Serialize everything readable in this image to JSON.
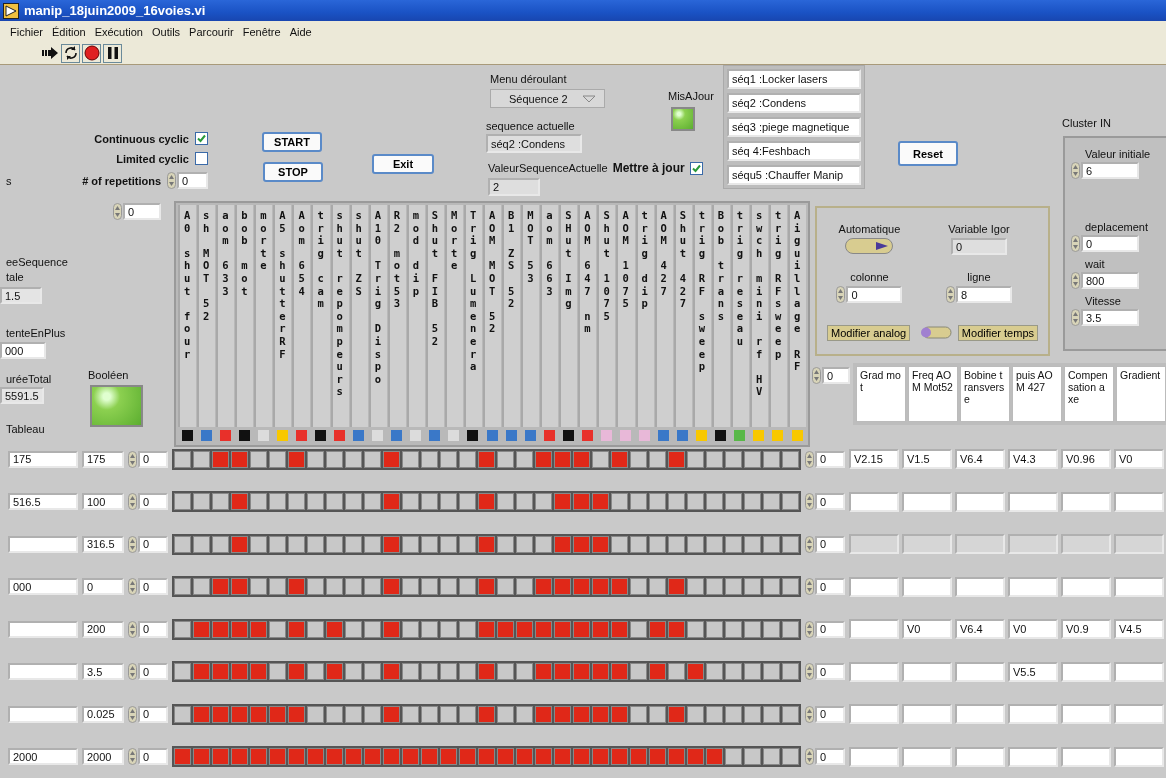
{
  "window": {
    "title": "manip_18juin2009_16voies.vi"
  },
  "menu": [
    "Fichier",
    "Édition",
    "Exécution",
    "Outils",
    "Parcourir",
    "Fenêtre",
    "Aide"
  ],
  "left_cut": {
    "top_label": "s",
    "duration_label": "eeSequence tale",
    "duration_value": "1.5",
    "wait_label": "tenteEnPlus",
    "wait_value": "000",
    "total_label": "uréeTotal",
    "total_value": "5591.5",
    "table_label": "Tableau"
  },
  "continuous_cyclic": {
    "label": "Continuous cyclic",
    "checked": true
  },
  "limited_cyclic": {
    "label": "Limited cyclic",
    "checked": false
  },
  "repetitions": {
    "label": "# of repetitions",
    "value": "0"
  },
  "buttons": {
    "start": "START",
    "stop": "STOP",
    "exit": "Exit",
    "reset": "Reset"
  },
  "dropdown": {
    "label": "Menu déroulant",
    "value": "Séquence 2"
  },
  "misajour": {
    "label": "MisAJour",
    "on": true
  },
  "sequence_actuelle": {
    "label": "sequence actuelle",
    "value": "séq2 :Condens"
  },
  "valeur_sequence": {
    "label": "ValeurSequenceActuelle",
    "value": "2"
  },
  "mettre_a_jour": {
    "label": "Mettre à jour",
    "checked": true
  },
  "sequences": [
    "séq1 :Locker lasers",
    "séq2 :Condens",
    "séq3 :piege magnetique",
    "séq 4:Feshbach",
    "séqu5 :Chauffer Manip"
  ],
  "booleen": {
    "label": "Booléen",
    "on": true
  },
  "cluster": {
    "label": "Cluster IN",
    "fields": [
      {
        "label": "Valeur initiale",
        "value": "6"
      },
      {
        "label": "deplacement",
        "value": "0"
      },
      {
        "label": "wait",
        "value": "800"
      },
      {
        "label": "Vitesse",
        "value": "3.5"
      }
    ]
  },
  "igor": {
    "automatique": {
      "label": "Automatique",
      "on": true
    },
    "variable": {
      "label": "Variable Igor",
      "value": "0"
    },
    "colonne": {
      "label": "colonne",
      "value": "0"
    },
    "ligne": {
      "label": "ligne",
      "value": "8"
    },
    "modifier_analog": "Modifier analog",
    "modifier_temps": "Modifier temps"
  },
  "channel_index": "0",
  "channels": [
    {
      "name": "A0 shut four",
      "color": "#111111"
    },
    {
      "name": "sh MOT 52",
      "color": "#3a78c8"
    },
    {
      "name": "aom 633",
      "color": "#e8302a"
    },
    {
      "name": "bob mot",
      "color": "#111111"
    },
    {
      "name": "morte",
      "color": "#dcdcdc"
    },
    {
      "name": "A5 shutterRF",
      "color": "#f8c800"
    },
    {
      "name": "Aom 654",
      "color": "#e8302a"
    },
    {
      "name": "trig cam",
      "color": "#111111"
    },
    {
      "name": "shut repompeurs",
      "color": "#e8302a"
    },
    {
      "name": "shut ZS",
      "color": "#3a78c8"
    },
    {
      "name": "A10 Trig Dispo",
      "color": "#dcdcdc"
    },
    {
      "name": "R2 mot53",
      "color": "#3a78c8"
    },
    {
      "name": "mod dip",
      "color": "#dcdcdc"
    },
    {
      "name": "Shut FIB 52",
      "color": "#3a78c8"
    },
    {
      "name": "Morte",
      "color": "#dcdcdc"
    },
    {
      "name": "Trig Lumenera",
      "color": "#111111"
    },
    {
      "name": "AOM MOT 52",
      "color": "#3a78c8"
    },
    {
      "name": "B1 ZS 52",
      "color": "#3a78c8"
    },
    {
      "name": "MOT 53",
      "color": "#3a78c8"
    },
    {
      "name": "aom 663",
      "color": "#e8302a"
    },
    {
      "name": "SHut Img",
      "color": "#111111"
    },
    {
      "name": "AOM 647 nm",
      "color": "#e8302a"
    },
    {
      "name": "Shut 1075",
      "color": "#e8b8d8"
    },
    {
      "name": "AOM 1075",
      "color": "#e8b8d8"
    },
    {
      "name": "trig dip",
      "color": "#e8b8d8"
    },
    {
      "name": "AOM 427",
      "color": "#3a78c8"
    },
    {
      "name": "Shut 427",
      "color": "#3a78c8"
    },
    {
      "name": "trig RF sweep",
      "color": "#f8c800"
    },
    {
      "name": "Bob trans",
      "color": "#111111"
    },
    {
      "name": "trig reseau",
      "color": "#58b848"
    },
    {
      "name": "swch mini rf HV",
      "color": "#f8c800"
    },
    {
      "name": "trig RFsweep",
      "color": "#f8c800"
    },
    {
      "name": "Aiguillage RF",
      "color": "#f8c800"
    }
  ],
  "analog_index": "0",
  "analog_headers": [
    "Grad mot",
    "Freq AOM Mot52",
    "Bobine transverse",
    "puis AOM 427",
    "Compensation axe",
    "Gradient"
  ],
  "rows": [
    {
      "time": "175",
      "duration": "175",
      "index": "0",
      "analog_index": "0",
      "analog": [
        {
          "value": "V2.15",
          "disabled": false
        },
        {
          "value": "V1.5",
          "disabled": false
        },
        {
          "value": "V6.4",
          "disabled": false
        },
        {
          "value": "V4.3",
          "disabled": false
        },
        {
          "value": "V0.96",
          "disabled": false
        },
        {
          "value": "V0",
          "disabled": false
        }
      ],
      "bits": [
        false,
        false,
        true,
        true,
        false,
        false,
        true,
        false,
        false,
        false,
        false,
        true,
        false,
        false,
        false,
        false,
        true,
        false,
        false,
        true,
        true,
        true,
        false,
        true,
        false,
        false,
        true,
        false,
        false,
        false,
        false,
        false,
        false
      ]
    },
    {
      "time": "516.5",
      "duration": "100",
      "index": "0",
      "analog_index": "0",
      "analog": [
        {
          "disabled": false
        },
        {
          "disabled": false
        },
        {
          "disabled": false
        },
        {
          "disabled": false
        },
        {
          "disabled": false
        },
        {
          "disabled": false
        }
      ],
      "bits": [
        false,
        false,
        false,
        true,
        false,
        false,
        false,
        false,
        false,
        false,
        false,
        true,
        false,
        false,
        false,
        false,
        true,
        false,
        false,
        false,
        true,
        true,
        true,
        false,
        false,
        false,
        false,
        false,
        false,
        false,
        false,
        false,
        false
      ]
    },
    {
      "duration": "316.5",
      "index": "0",
      "analog_index": "0",
      "analog": [
        {
          "disabled": true
        },
        {
          "disabled": true
        },
        {
          "disabled": true
        },
        {
          "disabled": true
        },
        {
          "disabled": true
        },
        {
          "disabled": true
        }
      ],
      "bits": [
        false,
        false,
        false,
        true,
        false,
        false,
        false,
        false,
        false,
        false,
        false,
        true,
        false,
        false,
        false,
        false,
        true,
        false,
        false,
        false,
        true,
        true,
        true,
        false,
        false,
        false,
        false,
        false,
        false,
        false,
        false,
        false,
        false
      ]
    },
    {
      "time": "000",
      "duration": "0",
      "index": "0",
      "analog_index": "0",
      "analog": [
        {
          "disabled": false
        },
        {
          "disabled": false
        },
        {
          "disabled": false
        },
        {
          "disabled": false
        },
        {
          "disabled": false
        },
        {
          "disabled": false
        }
      ],
      "bits": [
        false,
        false,
        true,
        true,
        false,
        false,
        true,
        false,
        false,
        false,
        false,
        true,
        false,
        false,
        false,
        false,
        true,
        false,
        false,
        true,
        true,
        true,
        true,
        true,
        false,
        false,
        true,
        false,
        false,
        false,
        false,
        false,
        false
      ]
    },
    {
      "duration": "200",
      "index": "0",
      "analog_index": "0",
      "analog": [
        {
          "disabled": false
        },
        {
          "value": "V0",
          "disabled": false
        },
        {
          "value": "V6.4",
          "disabled": false
        },
        {
          "value": "V0",
          "disabled": false
        },
        {
          "value": "V0.9",
          "disabled": false
        },
        {
          "value": "V4.5",
          "disabled": false
        }
      ],
      "bits": [
        false,
        true,
        true,
        true,
        true,
        false,
        true,
        false,
        true,
        false,
        false,
        true,
        false,
        false,
        false,
        false,
        true,
        true,
        true,
        true,
        true,
        true,
        true,
        true,
        false,
        true,
        true,
        false,
        false,
        false,
        false,
        false,
        false
      ]
    },
    {
      "duration": "3.5",
      "index": "0",
      "analog_index": "0",
      "analog": [
        {
          "disabled": false
        },
        {
          "disabled": false
        },
        {
          "disabled": false
        },
        {
          "value": "V5.5",
          "disabled": false
        },
        {
          "disabled": false
        },
        {
          "disabled": false
        }
      ],
      "bits": [
        false,
        true,
        true,
        true,
        true,
        false,
        true,
        false,
        true,
        false,
        false,
        true,
        false,
        false,
        false,
        false,
        true,
        false,
        false,
        true,
        true,
        true,
        true,
        true,
        false,
        true,
        false,
        true,
        false,
        false,
        false,
        false,
        false
      ]
    },
    {
      "duration": "0.025",
      "index": "0",
      "analog_index": "0",
      "analog": [
        {
          "disabled": false
        },
        {
          "disabled": false
        },
        {
          "disabled": false
        },
        {
          "disabled": false
        },
        {
          "disabled": false
        },
        {
          "disabled": false
        }
      ],
      "bits": [
        false,
        true,
        true,
        true,
        true,
        true,
        true,
        false,
        false,
        false,
        false,
        true,
        false,
        false,
        false,
        false,
        true,
        false,
        false,
        true,
        true,
        true,
        true,
        true,
        false,
        false,
        true,
        false,
        false,
        false,
        false,
        false,
        false
      ]
    },
    {
      "time": "2000",
      "duration": "2000",
      "index": "0",
      "analog_index": "0",
      "analog": [
        {
          "disabled": false
        },
        {
          "disabled": false
        },
        {
          "disabled": false
        },
        {
          "disabled": false
        },
        {
          "disabled": false
        },
        {
          "disabled": false
        }
      ],
      "bits": [
        true,
        true,
        true,
        true,
        true,
        true,
        true,
        true,
        true,
        true,
        true,
        true,
        true,
        true,
        true,
        true,
        true,
        true,
        true,
        true,
        true,
        true,
        true,
        true,
        true,
        true,
        true,
        true,
        true,
        false,
        false,
        false,
        false
      ]
    }
  ]
}
